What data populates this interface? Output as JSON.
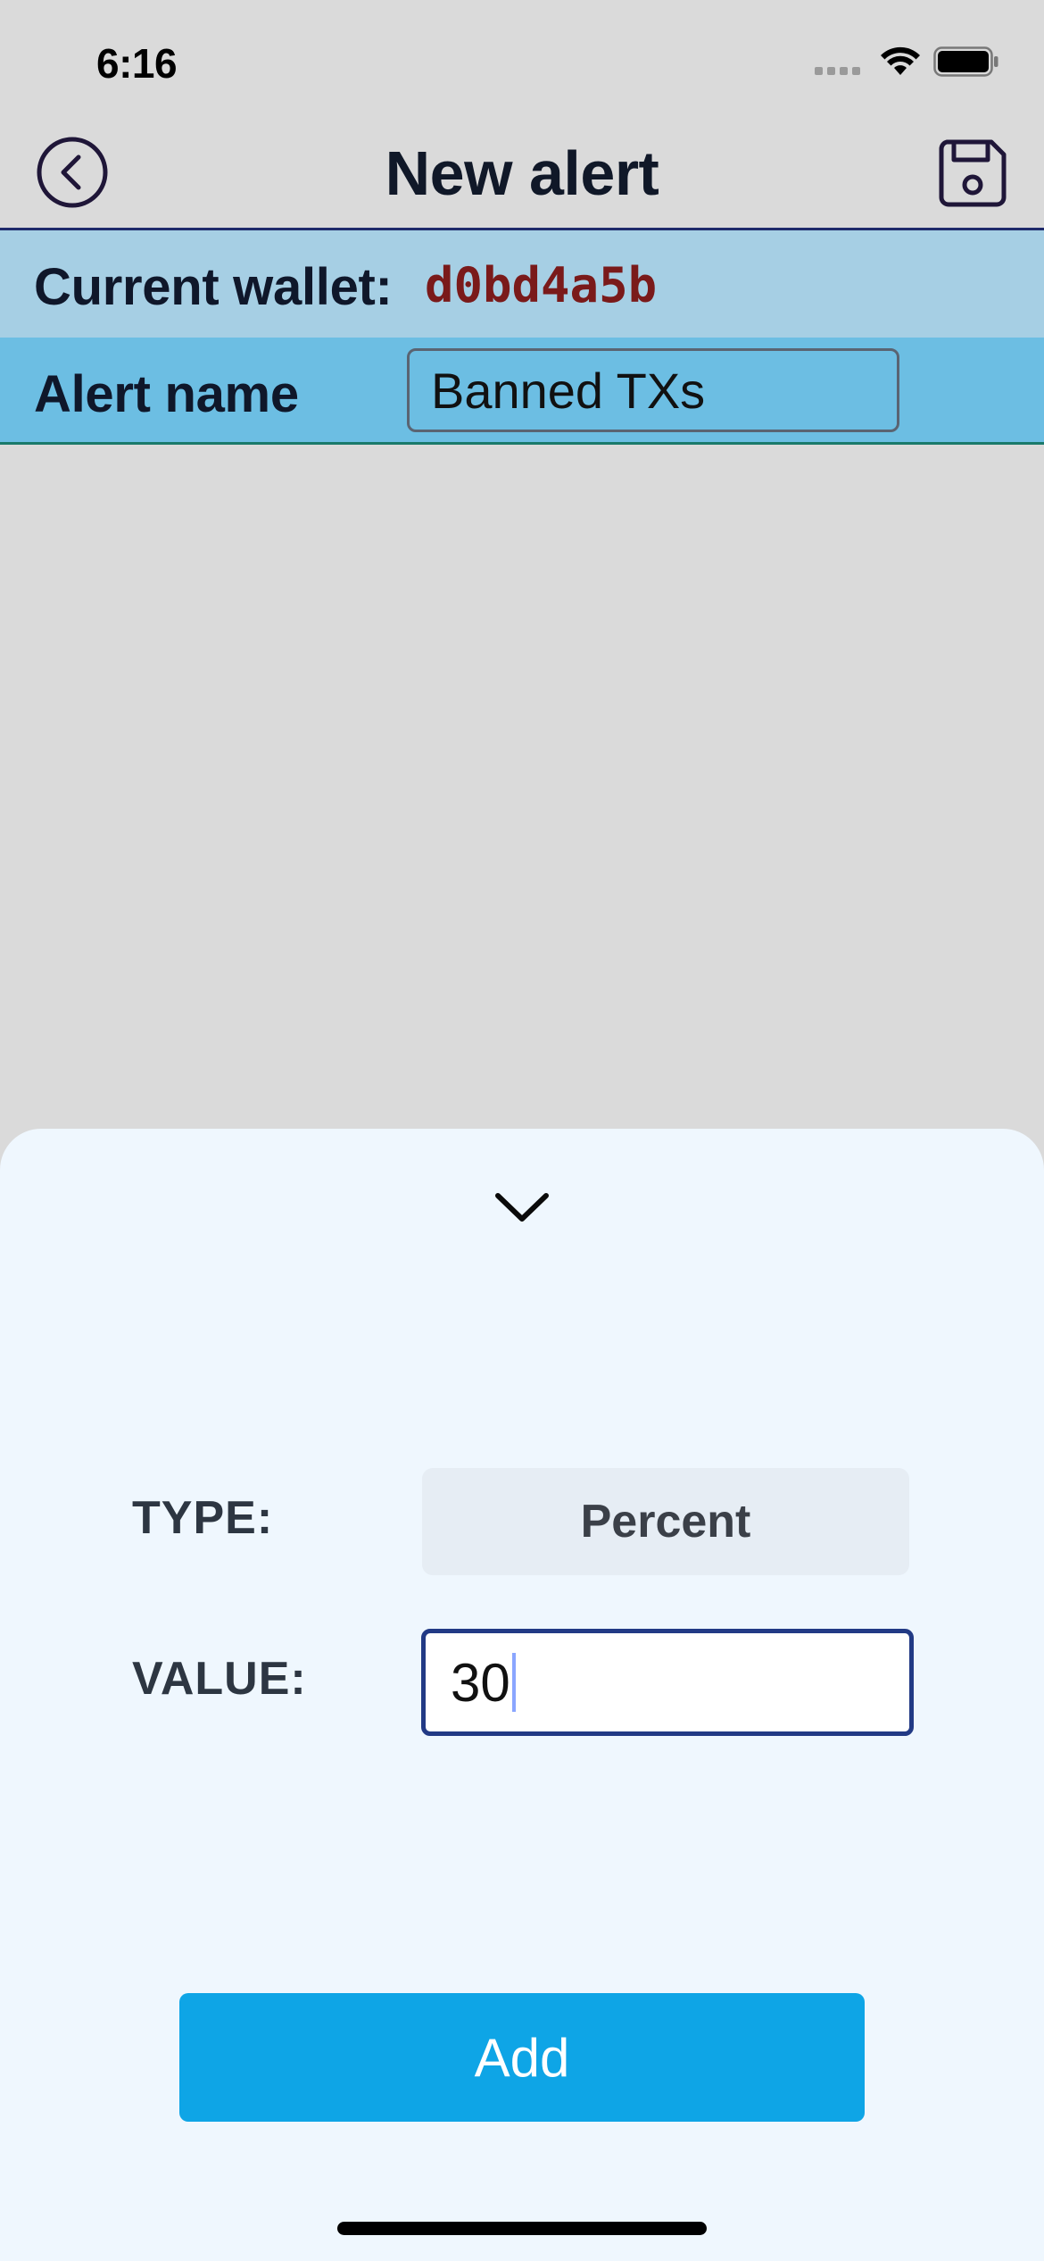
{
  "status_bar": {
    "time": "6:16",
    "icons": [
      "signal-icon",
      "wifi-icon",
      "battery-icon"
    ]
  },
  "nav": {
    "title": "New alert",
    "back_icon": "chevron-left-circle-icon",
    "save_icon": "floppy-disk-icon"
  },
  "wallet": {
    "label": "Current wallet:",
    "value": "d0bd4a5b"
  },
  "alert_name": {
    "label": "Alert name",
    "value": "Banned TXs"
  },
  "sheet": {
    "collapse_icon": "chevron-down-icon",
    "type_label": "TYPE:",
    "type_value": "Percent",
    "value_label": "VALUE:",
    "value_value": "30",
    "add_label": "Add"
  },
  "colors": {
    "background": "#dadada",
    "wallet_row": "#a6cfe4",
    "alert_row": "#6cbee3",
    "wallet_value": "#7a1a1a",
    "sheet": "#eff7fe",
    "accent_button": "#0ea5e6",
    "input_focus_border": "#223a85"
  }
}
